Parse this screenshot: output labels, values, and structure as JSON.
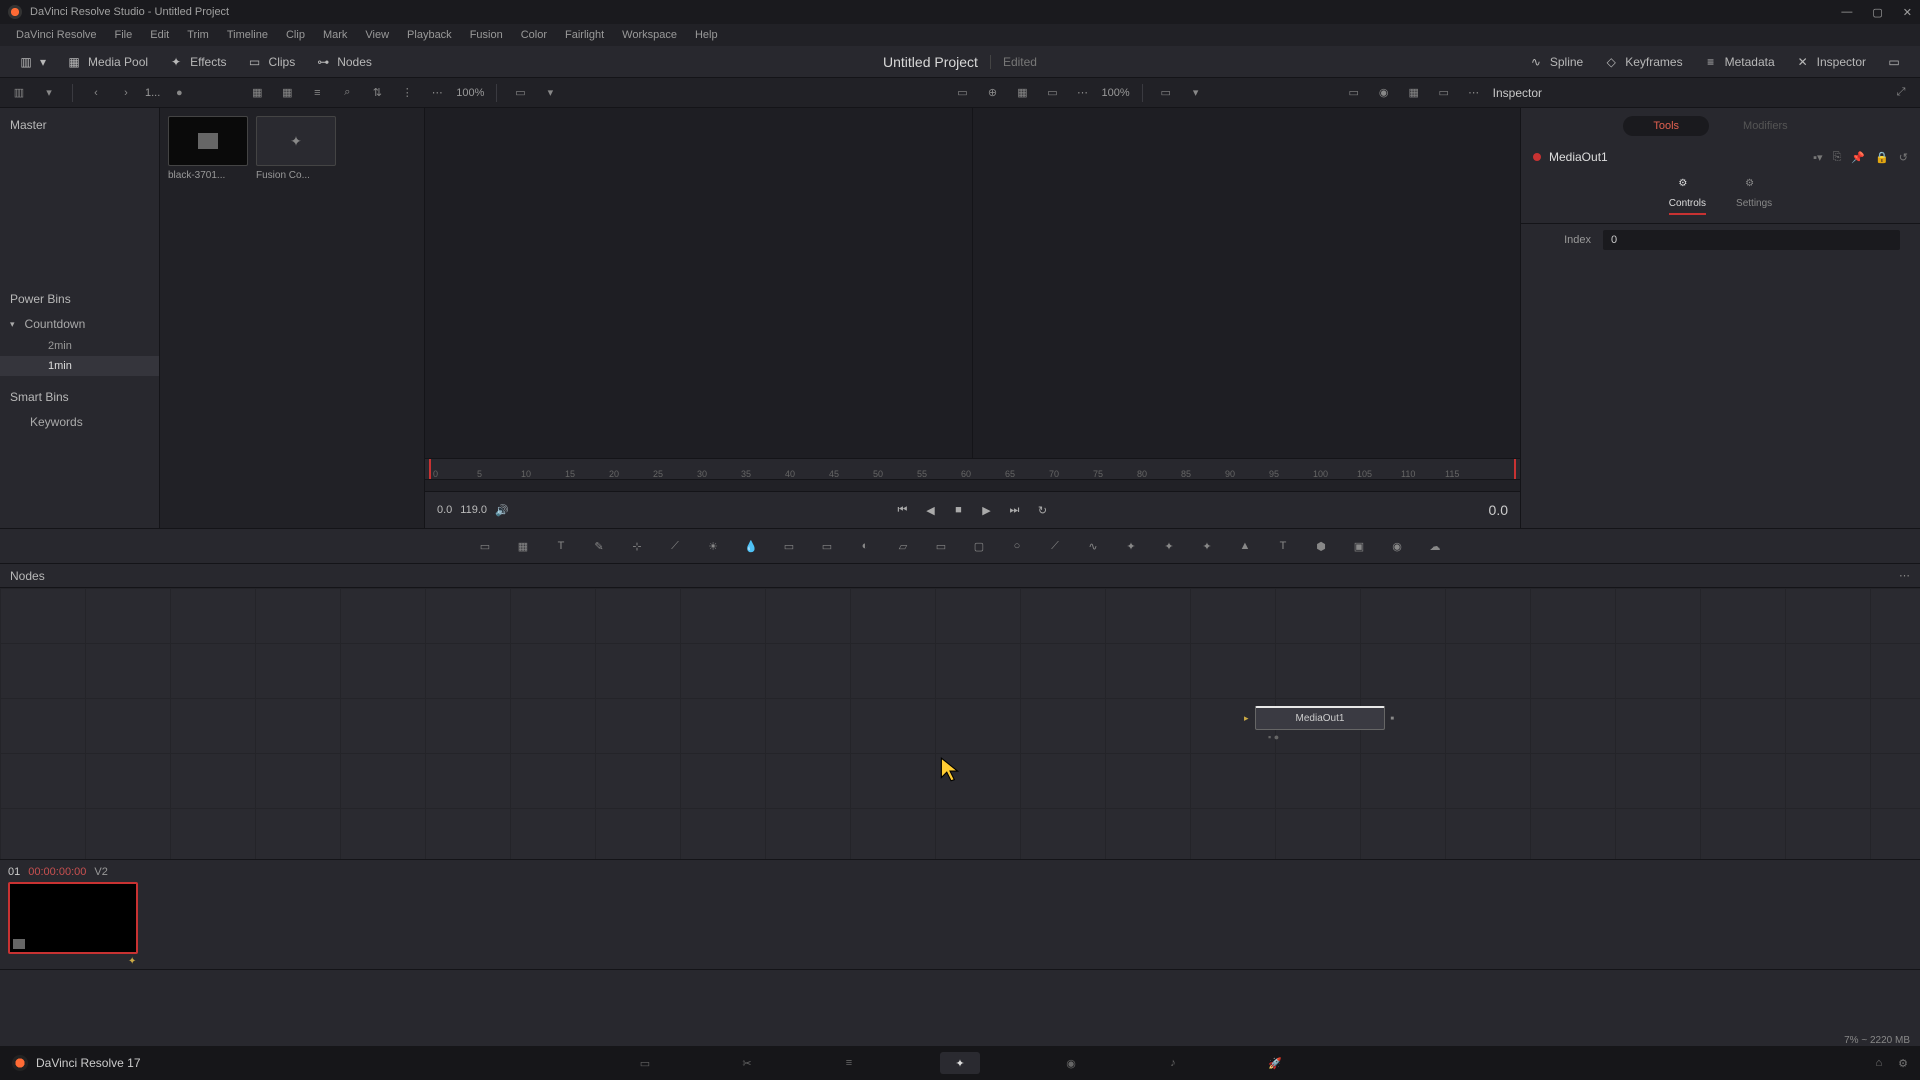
{
  "titlebar": {
    "text": "DaVinci Resolve Studio - Untitled Project"
  },
  "menu": [
    "DaVinci Resolve",
    "File",
    "Edit",
    "Trim",
    "Timeline",
    "Clip",
    "Mark",
    "View",
    "Playback",
    "Fusion",
    "Color",
    "Fairlight",
    "Workspace",
    "Help"
  ],
  "toolbar": {
    "media_pool": "Media Pool",
    "effects": "Effects",
    "clips": "Clips",
    "nodes": "Nodes",
    "spline": "Spline",
    "keyframes": "Keyframes",
    "metadata": "Metadata",
    "inspector": "Inspector"
  },
  "project": {
    "name": "Untitled Project",
    "status": "Edited"
  },
  "sectoolbar": {
    "label1": "1...",
    "zoom1": "100%",
    "zoom2": "100%"
  },
  "sidebar": {
    "master": "Master",
    "power_bins": "Power Bins",
    "countdown": "Countdown",
    "sub_2min": "2min",
    "sub_1min": "1min",
    "smart_bins": "Smart Bins",
    "keywords": "Keywords"
  },
  "thumbs": [
    {
      "label": "black-3701..."
    },
    {
      "label": "Fusion Co..."
    }
  ],
  "ruler_ticks": [
    "0",
    "5",
    "10",
    "15",
    "20",
    "25",
    "30",
    "35",
    "40",
    "45",
    "50",
    "55",
    "60",
    "65",
    "70",
    "75",
    "80",
    "85",
    "90",
    "95",
    "100",
    "105",
    "110",
    "115"
  ],
  "transport": {
    "start": "0.0",
    "end": "119.0",
    "current": "0.0"
  },
  "inspector": {
    "title": "Inspector",
    "tab_tools": "Tools",
    "tab_modifiers": "Modifiers",
    "node_name": "MediaOut1",
    "subtab_controls": "Controls",
    "subtab_settings": "Settings",
    "field_index_label": "Index",
    "field_index_value": "0"
  },
  "nodes": {
    "title": "Nodes",
    "node1": "MediaOut1"
  },
  "clip": {
    "index": "01",
    "tc": "00:00:00:00",
    "track": "V2"
  },
  "status": "7% ~ 2220 MB",
  "bottomnav": {
    "app": "DaVinci Resolve 17"
  }
}
